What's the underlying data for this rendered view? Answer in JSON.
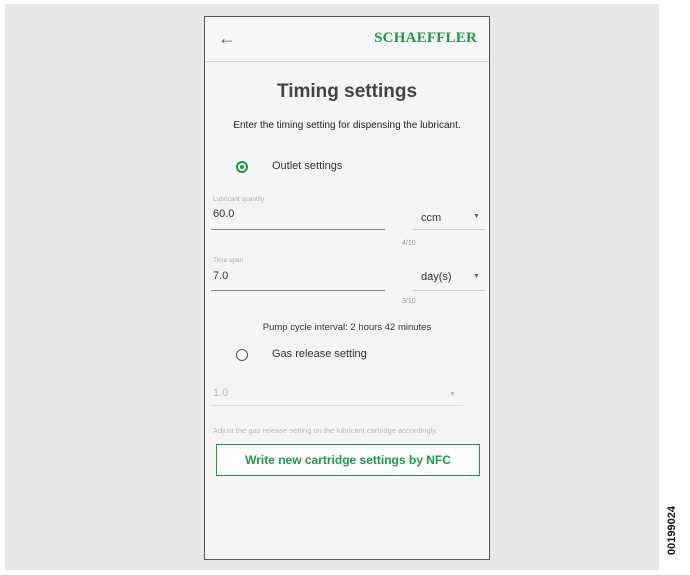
{
  "app": {
    "brand": "SCHAEFFLER"
  },
  "screen": {
    "title": "Timing settings",
    "subtitle": "Enter the timing setting for dispensing the lubricant."
  },
  "outlet": {
    "label": "Outlet settings",
    "selected": true,
    "lubricant_quantity": {
      "label": "Lubricant quantity",
      "value": "60.0",
      "unit": "ccm",
      "counter": "4/10"
    },
    "time_span": {
      "label": "Time span",
      "value": "7.0",
      "unit": "day(s)",
      "counter": "3/10"
    }
  },
  "interval_text": "Pump cycle interval: 2 hours 42 minutes",
  "gas_release": {
    "label": "Gas release setting",
    "selected": false,
    "value": "1.0",
    "hint": "Adjust the gas release setting on the lubricant cartridge accordingly."
  },
  "actions": {
    "write_label": "Write new cartridge settings by NFC"
  },
  "document_id": "00199024",
  "icons": {
    "back": "back-arrow-icon",
    "dropdown": "caret-down-icon"
  },
  "colors": {
    "accent": "#1a9a4a"
  }
}
